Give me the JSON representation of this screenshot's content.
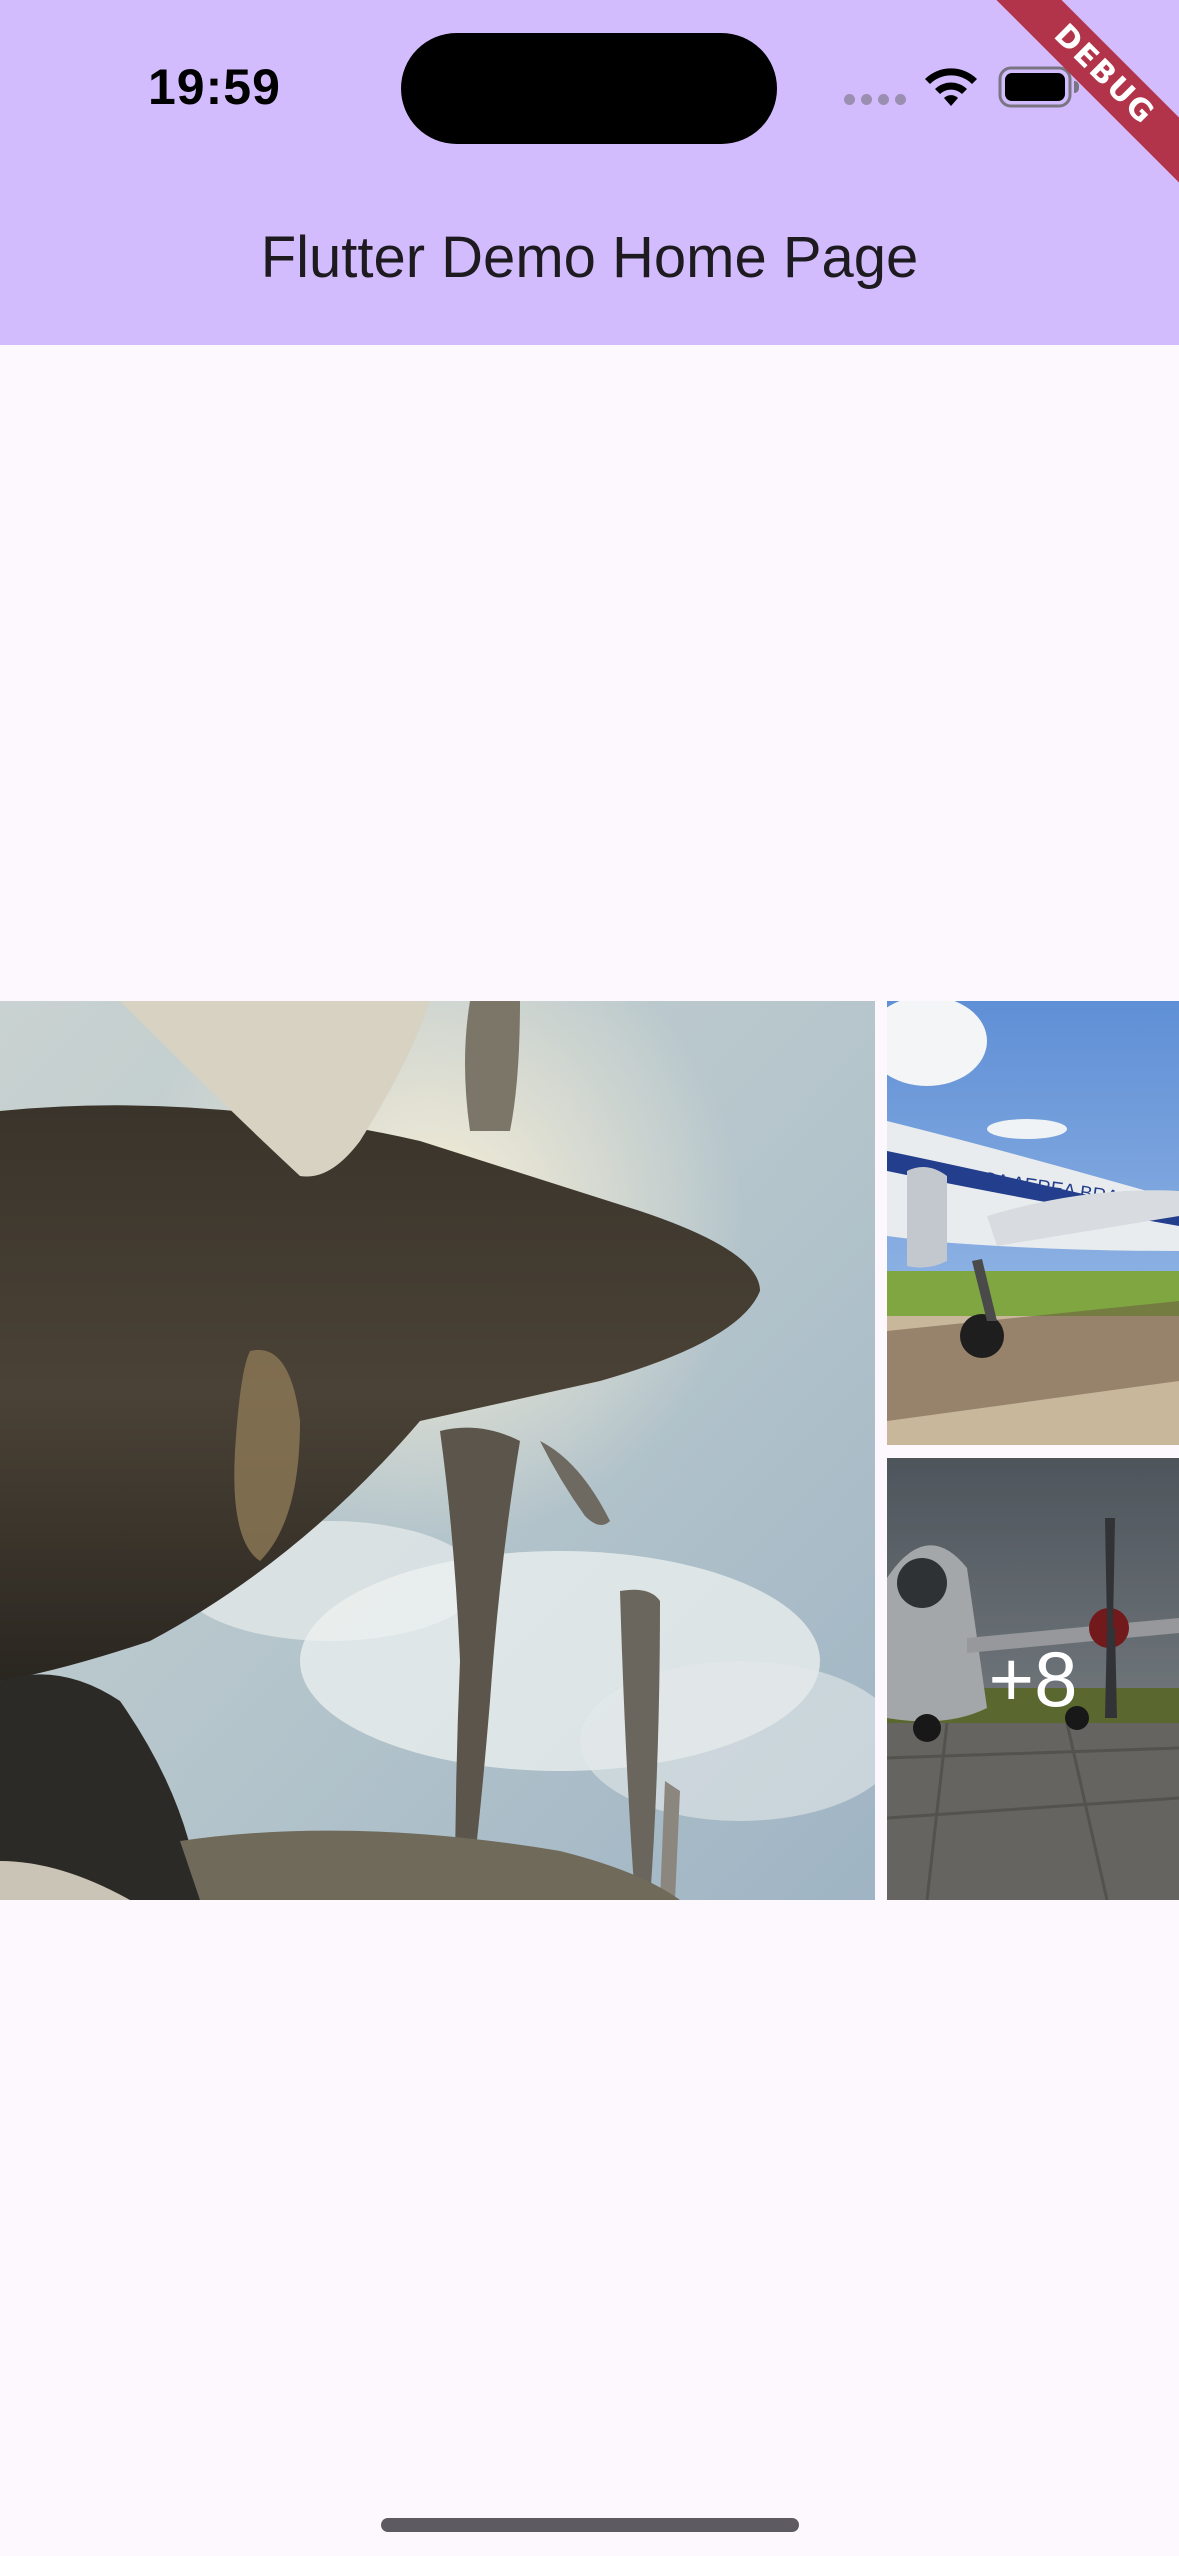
{
  "status_bar": {
    "time": "19:59",
    "icons": [
      "signal-dots-icon",
      "wifi-icon",
      "battery-icon"
    ]
  },
  "debug_banner": {
    "label": "DEBUG"
  },
  "app_bar": {
    "title": "Flutter Demo Home Page"
  },
  "gallery": {
    "photos": [
      {
        "name": "airplane-propeller-closeup"
      },
      {
        "name": "forca-aerea-brasileira-airplane",
        "caption": "FORCA AEREA BRASILEIR"
      },
      {
        "name": "propeller-airplane-on-tarmac"
      }
    ],
    "more_count": "+8"
  },
  "colors": {
    "app_bar_bg": "#D3BCFD",
    "page_bg": "#FDF7FE",
    "title_text": "#1D1B20",
    "debug_ribbon": "#B2344A"
  }
}
